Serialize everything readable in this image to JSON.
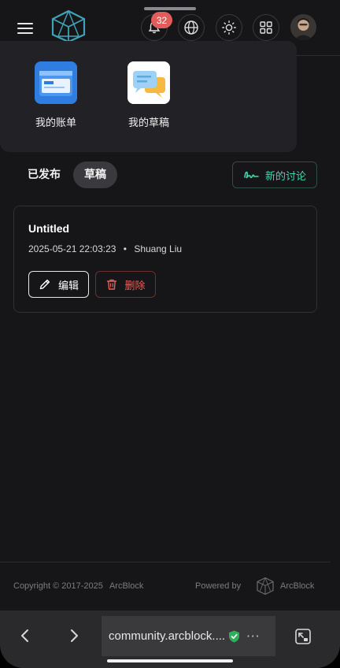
{
  "header": {
    "notification_count": "32"
  },
  "apps": [
    {
      "label": "我的账单",
      "icon": "bill-icon",
      "color": "#2f7de1"
    },
    {
      "label": "我的草稿",
      "icon": "draft-icon",
      "color": "#ffffff"
    }
  ],
  "tabs": {
    "published": "已发布",
    "drafts": "草稿"
  },
  "new_discussion_label": "新的讨论",
  "accent_color": "#43d5b0",
  "draft": {
    "title": "Untitled",
    "date": "2025-05-21 22:03:23",
    "separator": "•",
    "author": "Shuang Liu",
    "edit_label": "编辑",
    "delete_label": "删除"
  },
  "footer": {
    "copyright": "Copyright © 2017-2025",
    "company": "ArcBlock",
    "powered_by": "Powered by",
    "brand": "ArcBlock"
  },
  "browser": {
    "url": "community.arcblock....",
    "more": "···"
  }
}
